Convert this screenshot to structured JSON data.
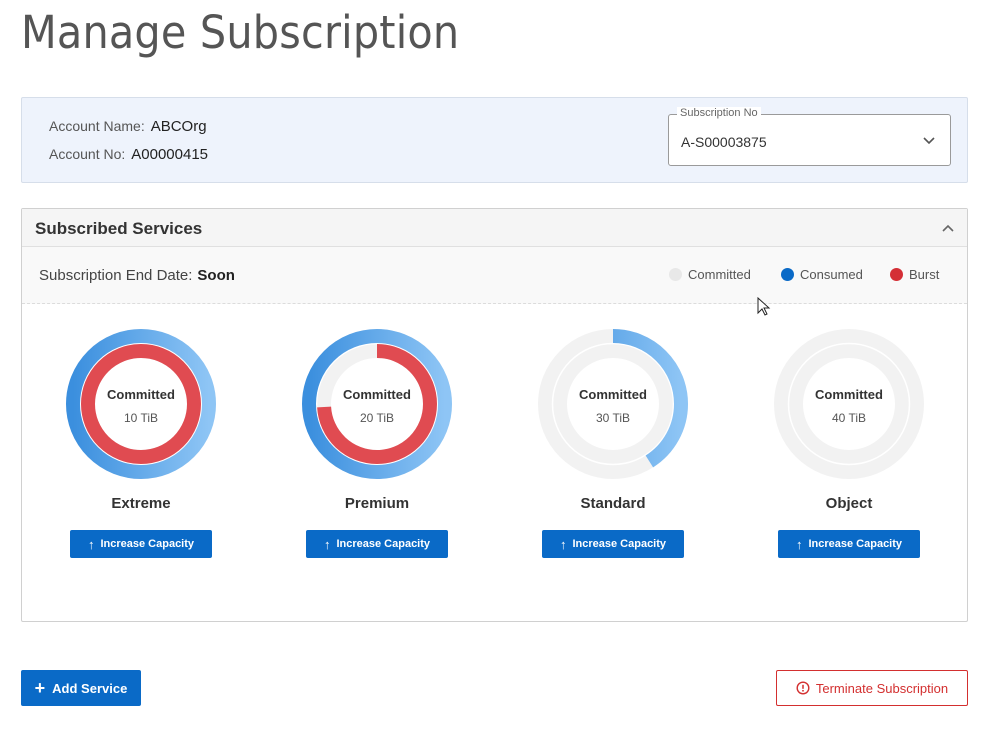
{
  "page": {
    "title": "Manage Subscription"
  },
  "account": {
    "name_label": "Account Name:",
    "name_value": "ABCOrg",
    "no_label": "Account No:",
    "no_value": "A00000415"
  },
  "subscription_select": {
    "legend": "Subscription No",
    "value": "A-S00003875",
    "icon": "chevron-down-icon"
  },
  "services_panel": {
    "title": "Subscribed Services",
    "collapse_icon": "chevron-up-icon",
    "end_date_label": "Subscription End Date:",
    "end_date_value": "Soon",
    "legend": [
      {
        "label": "Committed",
        "color": "#e8e8e8"
      },
      {
        "label": "Consumed",
        "color": "#0a6ac7"
      },
      {
        "label": "Burst",
        "color": "#d42f36"
      }
    ],
    "services": [
      {
        "name": "Extreme",
        "center_label": "Committed",
        "amount": "10 TiB",
        "consumed_fraction": 1.0,
        "burst_fraction": 1.0,
        "button": "Increase Capacity"
      },
      {
        "name": "Premium",
        "center_label": "Committed",
        "amount": "20 TiB",
        "consumed_fraction": 1.0,
        "burst_fraction": 0.74,
        "button": "Increase Capacity"
      },
      {
        "name": "Standard",
        "center_label": "Committed",
        "amount": "30 TiB",
        "consumed_fraction": 0.41,
        "burst_fraction": 0,
        "button": "Increase Capacity"
      },
      {
        "name": "Object",
        "center_label": "Committed",
        "amount": "40 TiB",
        "consumed_fraction": 0,
        "burst_fraction": 0,
        "button": "Increase Capacity"
      }
    ]
  },
  "actions": {
    "add_service": "Add Service",
    "terminate": "Terminate Subscription"
  },
  "colors": {
    "primary": "#0a6ac7",
    "danger": "#d32f2f",
    "consumed_light": "#8ec5f5",
    "consumed_dark": "#3b8fde",
    "burst": "#e04b51",
    "track": "#f2f2f2"
  }
}
